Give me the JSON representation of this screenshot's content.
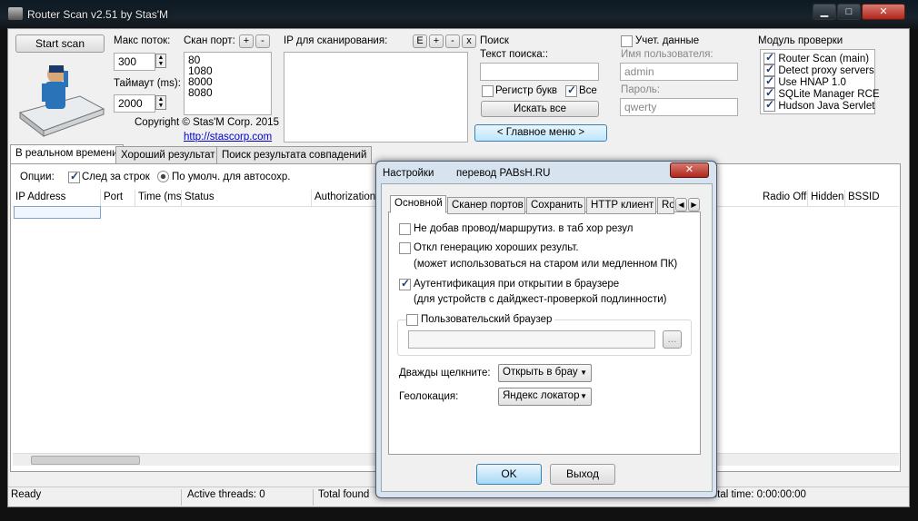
{
  "window": {
    "title": "Router Scan v2.51 by Stas'M",
    "min": "▁",
    "max": "□",
    "close": "✕"
  },
  "controls": {
    "start_scan": "Start scan",
    "max_threads_label": "Макс поток:",
    "max_threads_value": "300",
    "timeout_label": "Таймаут (ms):",
    "timeout_value": "2000",
    "scan_ports_label": "Скан порт:",
    "ports": [
      "80",
      "1080",
      "8000",
      "8080"
    ],
    "ip_label": "IP для сканирования:",
    "plus": "+",
    "minus": "-",
    "edit": "E",
    "clear": "x",
    "copyright": "Copyright © Stas'M Corp. 2015",
    "link": "http://stascorp.com"
  },
  "search": {
    "title": "Поиск",
    "text_label": "Текст поиска::",
    "case_label": "Регистр букв",
    "all_label": "Все",
    "find_all": "Искать все",
    "main_menu": "< Главное меню >"
  },
  "account": {
    "title": "Учет. данные",
    "user_label": "Имя пользователя:",
    "user_value": "admin",
    "pass_label": "Пароль:",
    "pass_value": "qwerty"
  },
  "modules": {
    "title": "Модуль проверки",
    "items": [
      "Router Scan (main)",
      "Detect proxy servers",
      "Use HNAP 1.0",
      "SQLite Manager RCE",
      "Hudson Java Servlet"
    ]
  },
  "tabs": [
    "В реальном времени",
    "Хороший результат",
    "Поиск результата совпадений"
  ],
  "options": {
    "label": "Опции:",
    "follow": "След за строк",
    "default": "По умолч. для автосохр."
  },
  "columns": [
    "IP Address",
    "Port",
    "Time (ms)",
    "Status",
    "Authorization",
    "Radio Off",
    "Hidden",
    "BSSID"
  ],
  "status": {
    "ready": "Ready",
    "threads": "Active threads: 0",
    "found": "Total found",
    "time": "Total time: 0:00:00:00"
  },
  "dialog": {
    "title": "Настройки",
    "credit": "перевод PABsH.RU",
    "close": "✕",
    "tabs": [
      "Основной",
      "Сканер портов",
      "Сохранить",
      "HTTP клиент",
      "Ro"
    ],
    "opt1": "Не добав провод/маршрутиз. в таб хор резул",
    "opt2": "Откл генерацию хороших результ.",
    "opt2_note": "(может использоваться на старом или медленном ПК)",
    "opt3": "Аутентификация при открытии в браузере",
    "opt3_note": "(для устройств с дайджест-проверкой подлинности)",
    "custom_browser": "Пользовательский браузер",
    "browse": "...",
    "dblclick_label": "Дважды щелкните:",
    "dblclick_value": "Открыть в брау",
    "geo_label": "Геолокация:",
    "geo_value": "Яндекс локатор",
    "ok": "OK",
    "exit": "Выход"
  }
}
